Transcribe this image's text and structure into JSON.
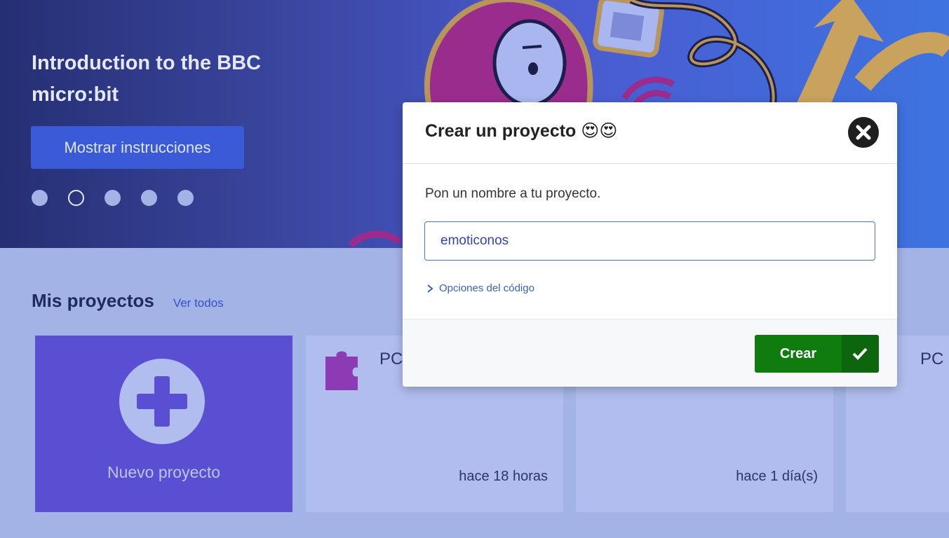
{
  "hero": {
    "title": "Introduction to the BBC micro:bit",
    "button_label": "Mostrar instrucciones",
    "carousel_count": 5,
    "carousel_active_index": 1
  },
  "projects": {
    "heading": "Mis proyectos",
    "view_all_label": "Ver todos",
    "new_project_label": "Nuevo proyecto",
    "cards": [
      {
        "name": "PC",
        "time": "hace 18 horas",
        "icon": "puzzle-icon"
      },
      {
        "name": "",
        "time": "hace 1 día(s)"
      },
      {
        "name": "PC",
        "time": ""
      }
    ]
  },
  "modal": {
    "title": "Crear un proyecto 😍😍",
    "prompt": "Pon un nombre a tu proyecto.",
    "input_value": "emoticonos",
    "code_options_label": "Opciones del código",
    "create_label": "Crear"
  },
  "colors": {
    "accent": "#3a5ad8",
    "new_project": "#5a4fd2",
    "create_button": "#107c10",
    "page_background": "#a4b3e6"
  }
}
